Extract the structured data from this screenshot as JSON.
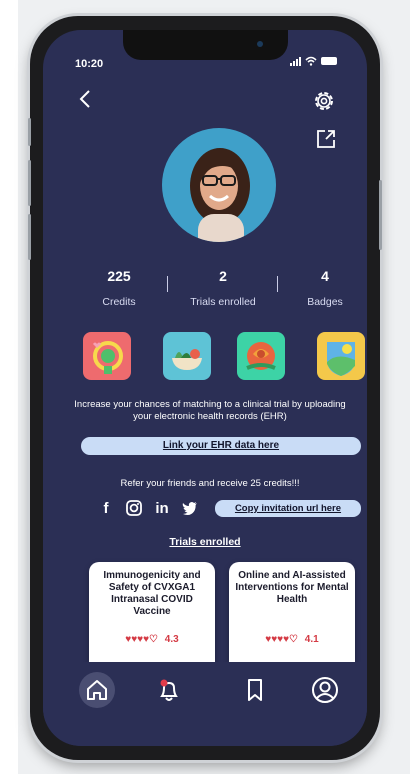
{
  "status_bar": {
    "time": "10:20"
  },
  "icons": {
    "back": "chevron-left-icon",
    "settings": "gear-icon",
    "share": "external-link-icon"
  },
  "profile": {
    "stats": [
      {
        "value": "225",
        "label": "Credits"
      },
      {
        "value": "2",
        "label": "Trials enrolled"
      },
      {
        "value": "4",
        "label": "Badges"
      }
    ],
    "badges": [
      {
        "name": "heart-badge",
        "color": "#ee6b6e"
      },
      {
        "name": "food-bowl-badge",
        "color": "#5ec3d6"
      },
      {
        "name": "rose-badge",
        "color": "#3dd3a6"
      },
      {
        "name": "shield-landscape-badge",
        "color": "#f4c84a"
      }
    ]
  },
  "ehr": {
    "text": "Increase your chances of matching to a clinical trial by uploading your electronic health records (EHR)",
    "button": "Link your EHR data here"
  },
  "refer": {
    "text": "Refer your friends and receive 25 credits!!!",
    "social": [
      "f",
      "instagram-icon",
      "in",
      "twitter-icon"
    ],
    "copy_button": "Copy invitation url here"
  },
  "trials": {
    "heading": "Trials enrolled",
    "items": [
      {
        "title": "Immunogenicity and Safety of CVXGA1 Intranasal COVID Vaccine",
        "hearts": "♥♥♥♥♡",
        "score": "4.3"
      },
      {
        "title": "Online and AI-assisted Interventions for Mental Health",
        "hearts": "♥♥♥♥♡",
        "score": "4.1"
      }
    ]
  },
  "nav": [
    "home-icon",
    "bell-icon",
    "bookmark-icon",
    "profile-icon"
  ],
  "colors": {
    "screen_bg": "#2b2f55",
    "pill_bg": "#c9dcf6",
    "heart": "#d43a44"
  }
}
